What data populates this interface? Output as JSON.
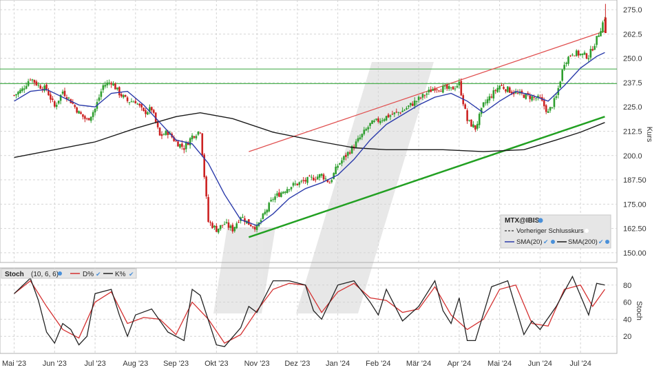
{
  "chart_data": {
    "type": "line",
    "price_panel": {
      "ylabel": "Kurs",
      "ylim": [
        145,
        280
      ],
      "y_ticks": [
        "275.0",
        "262.5",
        "250.0",
        "237.5",
        "225.0",
        "212.5",
        "200.0",
        "187.50",
        "175.00",
        "162.50",
        "150.00"
      ],
      "y_tick_values": [
        275,
        262.5,
        250,
        237.5,
        225,
        212.5,
        200,
        187.5,
        175,
        162.5,
        150
      ],
      "grid": true,
      "legend": {
        "placement": "bottom-right",
        "symbol": "MTX@IBIS",
        "items": [
          "Vorheriger Schlusskurs",
          "SMA(20)",
          "SMA(200)"
        ]
      },
      "horizontal_lines": [
        244.5,
        237.0
      ],
      "trend_channel": {
        "upper": [
          [
            5.8,
            202
          ],
          [
            14.6,
            264
          ]
        ],
        "lower": [
          [
            5.8,
            158
          ],
          [
            14.6,
            220
          ]
        ]
      },
      "close": [
        [
          0,
          231
        ],
        [
          0.2,
          234
        ],
        [
          0.4,
          240
        ],
        [
          0.6,
          236
        ],
        [
          0.8,
          234
        ],
        [
          1.0,
          225
        ],
        [
          1.2,
          233
        ],
        [
          1.4,
          228
        ],
        [
          1.6,
          222
        ],
        [
          1.8,
          218
        ],
        [
          2.0,
          224
        ],
        [
          2.2,
          236
        ],
        [
          2.4,
          238
        ],
        [
          2.6,
          232
        ],
        [
          2.8,
          228
        ],
        [
          3.0,
          228
        ],
        [
          3.2,
          222
        ],
        [
          3.4,
          224
        ],
        [
          3.6,
          210
        ],
        [
          3.8,
          212
        ],
        [
          4.0,
          207
        ],
        [
          4.2,
          204
        ],
        [
          4.4,
          210
        ],
        [
          4.6,
          213
        ],
        [
          4.8,
          166
        ],
        [
          5.0,
          162
        ],
        [
          5.2,
          165
        ],
        [
          5.4,
          162
        ],
        [
          5.6,
          169
        ],
        [
          5.8,
          165
        ],
        [
          6.0,
          163
        ],
        [
          6.4,
          178
        ],
        [
          6.8,
          184
        ],
        [
          7.2,
          187
        ],
        [
          7.6,
          190
        ],
        [
          7.8,
          186
        ],
        [
          8.0,
          195
        ],
        [
          8.4,
          205
        ],
        [
          8.8,
          216
        ],
        [
          9.2,
          220
        ],
        [
          9.6,
          223
        ],
        [
          10.0,
          229
        ],
        [
          10.4,
          235
        ],
        [
          10.8,
          234
        ],
        [
          11.0,
          237
        ],
        [
          11.2,
          218
        ],
        [
          11.4,
          214
        ],
        [
          11.6,
          226
        ],
        [
          12.0,
          236
        ],
        [
          12.4,
          232
        ],
        [
          12.8,
          230
        ],
        [
          13.0,
          229
        ],
        [
          13.2,
          222
        ],
        [
          13.4,
          230
        ],
        [
          13.6,
          248
        ],
        [
          13.8,
          253
        ],
        [
          14.2,
          251
        ],
        [
          14.4,
          260
        ],
        [
          14.6,
          271
        ]
      ],
      "sma20": [
        [
          0,
          228
        ],
        [
          0.4,
          233
        ],
        [
          0.8,
          234
        ],
        [
          1.2,
          230
        ],
        [
          1.6,
          226
        ],
        [
          2.0,
          225
        ],
        [
          2.4,
          232
        ],
        [
          2.8,
          233
        ],
        [
          3.2,
          226
        ],
        [
          3.6,
          217
        ],
        [
          4.0,
          208
        ],
        [
          4.4,
          206
        ],
        [
          4.8,
          196
        ],
        [
          5.2,
          180
        ],
        [
          5.6,
          167
        ],
        [
          6.0,
          164
        ],
        [
          6.4,
          170
        ],
        [
          6.8,
          178
        ],
        [
          7.2,
          183
        ],
        [
          7.6,
          186
        ],
        [
          8.0,
          190
        ],
        [
          8.4,
          198
        ],
        [
          8.8,
          208
        ],
        [
          9.2,
          216
        ],
        [
          9.6,
          221
        ],
        [
          10.0,
          226
        ],
        [
          10.4,
          230
        ],
        [
          10.8,
          232
        ],
        [
          11.2,
          228
        ],
        [
          11.6,
          222
        ],
        [
          12.0,
          228
        ],
        [
          12.4,
          233
        ],
        [
          12.8,
          231
        ],
        [
          13.2,
          228
        ],
        [
          13.6,
          236
        ],
        [
          14.0,
          245
        ],
        [
          14.4,
          251
        ],
        [
          14.6,
          253
        ]
      ],
      "sma200": [
        [
          0,
          199
        ],
        [
          1.0,
          203
        ],
        [
          2.0,
          207
        ],
        [
          3.0,
          214
        ],
        [
          4.0,
          220
        ],
        [
          4.6,
          222
        ],
        [
          5.4,
          219
        ],
        [
          6.4,
          212
        ],
        [
          7.6,
          207
        ],
        [
          8.4,
          204
        ],
        [
          9.2,
          203
        ],
        [
          10.6,
          203
        ],
        [
          11.6,
          202
        ],
        [
          12.6,
          203
        ],
        [
          13.4,
          208
        ],
        [
          14.0,
          212
        ],
        [
          14.6,
          217
        ]
      ]
    },
    "stoch_panel": {
      "title": "Stoch",
      "params": "(10, 6, 6)",
      "series_labels": [
        "D%",
        "K%"
      ],
      "ylabel": "Stoch",
      "ylim": [
        0,
        100
      ],
      "y_ticks": [
        "80",
        "60",
        "40",
        "20"
      ],
      "y_tick_values": [
        80,
        60,
        40,
        20
      ],
      "k": [
        [
          0,
          70
        ],
        [
          0.4,
          88
        ],
        [
          0.6,
          62
        ],
        [
          0.8,
          25
        ],
        [
          1.0,
          12
        ],
        [
          1.2,
          35
        ],
        [
          1.4,
          28
        ],
        [
          1.6,
          10
        ],
        [
          1.8,
          20
        ],
        [
          2.0,
          70
        ],
        [
          2.4,
          75
        ],
        [
          2.6,
          45
        ],
        [
          2.8,
          20
        ],
        [
          3.0,
          45
        ],
        [
          3.4,
          52
        ],
        [
          3.8,
          25
        ],
        [
          4.2,
          15
        ],
        [
          4.4,
          75
        ],
        [
          4.6,
          68
        ],
        [
          5.0,
          10
        ],
        [
          5.2,
          8
        ],
        [
          5.6,
          30
        ],
        [
          5.8,
          55
        ],
        [
          6.0,
          48
        ],
        [
          6.4,
          85
        ],
        [
          6.8,
          85
        ],
        [
          7.2,
          80
        ],
        [
          7.4,
          50
        ],
        [
          7.6,
          40
        ],
        [
          8.0,
          80
        ],
        [
          8.4,
          85
        ],
        [
          8.8,
          60
        ],
        [
          9.0,
          45
        ],
        [
          9.2,
          75
        ],
        [
          9.6,
          38
        ],
        [
          10.0,
          55
        ],
        [
          10.4,
          85
        ],
        [
          10.6,
          50
        ],
        [
          10.8,
          35
        ],
        [
          11.0,
          65
        ],
        [
          11.2,
          15
        ],
        [
          11.4,
          15
        ],
        [
          11.8,
          78
        ],
        [
          12.2,
          85
        ],
        [
          12.6,
          22
        ],
        [
          12.8,
          38
        ],
        [
          13.0,
          28
        ],
        [
          13.4,
          55
        ],
        [
          13.8,
          90
        ],
        [
          14.2,
          45
        ],
        [
          14.4,
          82
        ],
        [
          14.6,
          80
        ]
      ],
      "d": [
        [
          0,
          70
        ],
        [
          0.4,
          85
        ],
        [
          0.8,
          55
        ],
        [
          1.2,
          28
        ],
        [
          1.6,
          18
        ],
        [
          2.0,
          60
        ],
        [
          2.4,
          72
        ],
        [
          2.8,
          35
        ],
        [
          3.2,
          42
        ],
        [
          3.6,
          40
        ],
        [
          4.0,
          22
        ],
        [
          4.4,
          60
        ],
        [
          4.8,
          40
        ],
        [
          5.2,
          12
        ],
        [
          5.6,
          22
        ],
        [
          6.0,
          50
        ],
        [
          6.4,
          75
        ],
        [
          6.8,
          82
        ],
        [
          7.2,
          80
        ],
        [
          7.6,
          48
        ],
        [
          8.0,
          72
        ],
        [
          8.4,
          82
        ],
        [
          8.8,
          65
        ],
        [
          9.2,
          62
        ],
        [
          9.6,
          48
        ],
        [
          10.0,
          52
        ],
        [
          10.4,
          78
        ],
        [
          10.8,
          45
        ],
        [
          11.2,
          28
        ],
        [
          11.6,
          40
        ],
        [
          12.0,
          75
        ],
        [
          12.4,
          80
        ],
        [
          12.8,
          35
        ],
        [
          13.2,
          32
        ],
        [
          13.6,
          75
        ],
        [
          14.0,
          80
        ],
        [
          14.3,
          55
        ],
        [
          14.6,
          75
        ]
      ]
    },
    "x_labels": [
      "Mai '23",
      "Jun '23",
      "Jul '23",
      "Aug '23",
      "Sep '23",
      "Okt '23",
      "Nov '23",
      "Dez '23",
      "Jan '24",
      "Feb '24",
      "Mär '24",
      "Apr '24",
      "Mai '24",
      "Jun '24",
      "Jul '24"
    ],
    "x_label_index": [
      0,
      1,
      2,
      3,
      4,
      5,
      6,
      7,
      8,
      9,
      10,
      11,
      12,
      13,
      14
    ],
    "x_range": [
      -0.35,
      14.9
    ]
  },
  "colors": {
    "up": "#2e9e2e",
    "down": "#cc2222",
    "sma20": "#2a3aaa",
    "sma200": "#1a1a1a",
    "channel_upper": "#e05050",
    "channel_lower": "#22a022",
    "hline": "#4caf50",
    "d_line": "#d43030",
    "k_line": "#222222",
    "grid": "#d4d4d4"
  }
}
